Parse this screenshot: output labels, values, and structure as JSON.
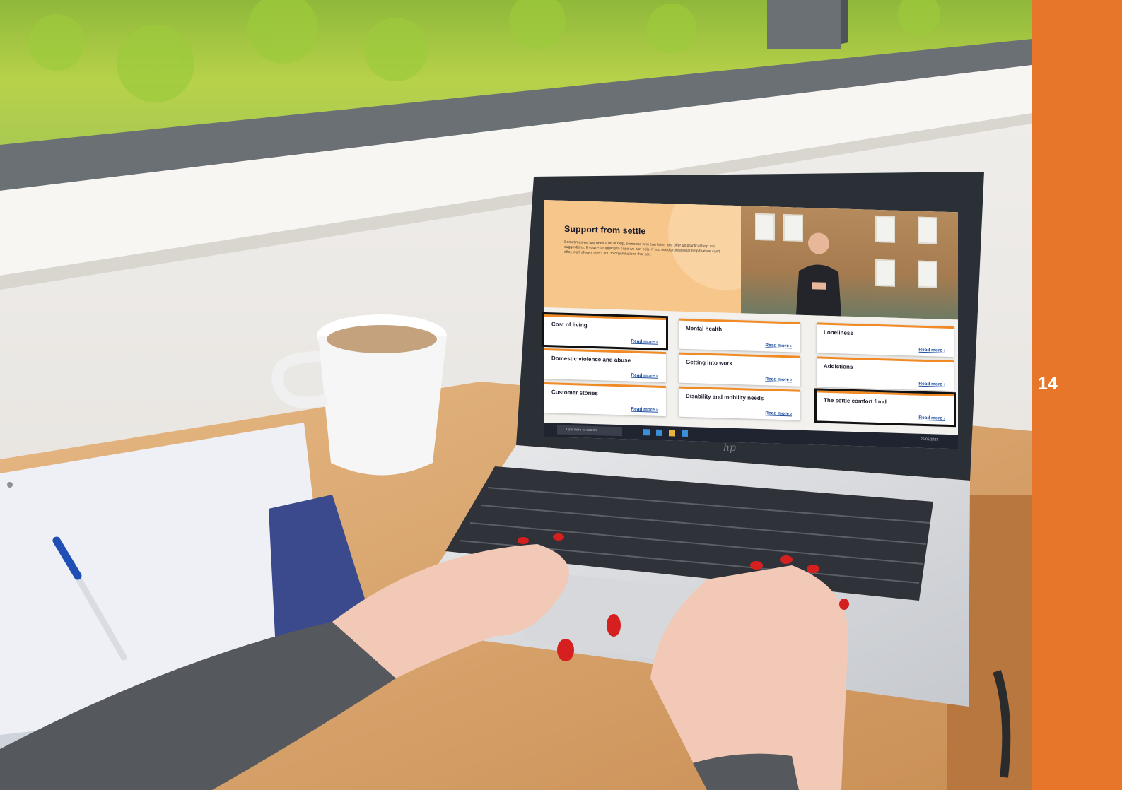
{
  "page": {
    "number": "14",
    "accent_color": "#e8762a"
  },
  "laptop": {
    "brand_logo": "hp",
    "screen": {
      "hero": {
        "title": "Support from settle",
        "body": "Sometimes we just need a bit of help, someone who can listen and offer us practical help and suggestions. If you're struggling to cope we can help. If you need professional help that we can't offer, we'll always direct you to organisations that can."
      },
      "cards": [
        {
          "title": "Cost of living",
          "link": "Read more ›",
          "highlighted": true
        },
        {
          "title": "Mental health",
          "link": "Read more ›",
          "highlighted": false
        },
        {
          "title": "Loneliness",
          "link": "Read more ›",
          "highlighted": false
        },
        {
          "title": "Domestic violence and abuse",
          "link": "Read more ›",
          "highlighted": false
        },
        {
          "title": "Getting into work",
          "link": "Read more ›",
          "highlighted": false
        },
        {
          "title": "Addictions",
          "link": "Read more ›",
          "highlighted": false
        },
        {
          "title": "Customer stories",
          "link": "Read more ›",
          "highlighted": false
        },
        {
          "title": "Disability and mobility needs",
          "link": "Read more ›",
          "highlighted": false
        },
        {
          "title": "The settle comfort fund",
          "link": "Read more ›",
          "highlighted": true
        }
      ],
      "taskbar": {
        "search_placeholder": "Type here to search",
        "clock": "25/05/2023"
      }
    }
  }
}
